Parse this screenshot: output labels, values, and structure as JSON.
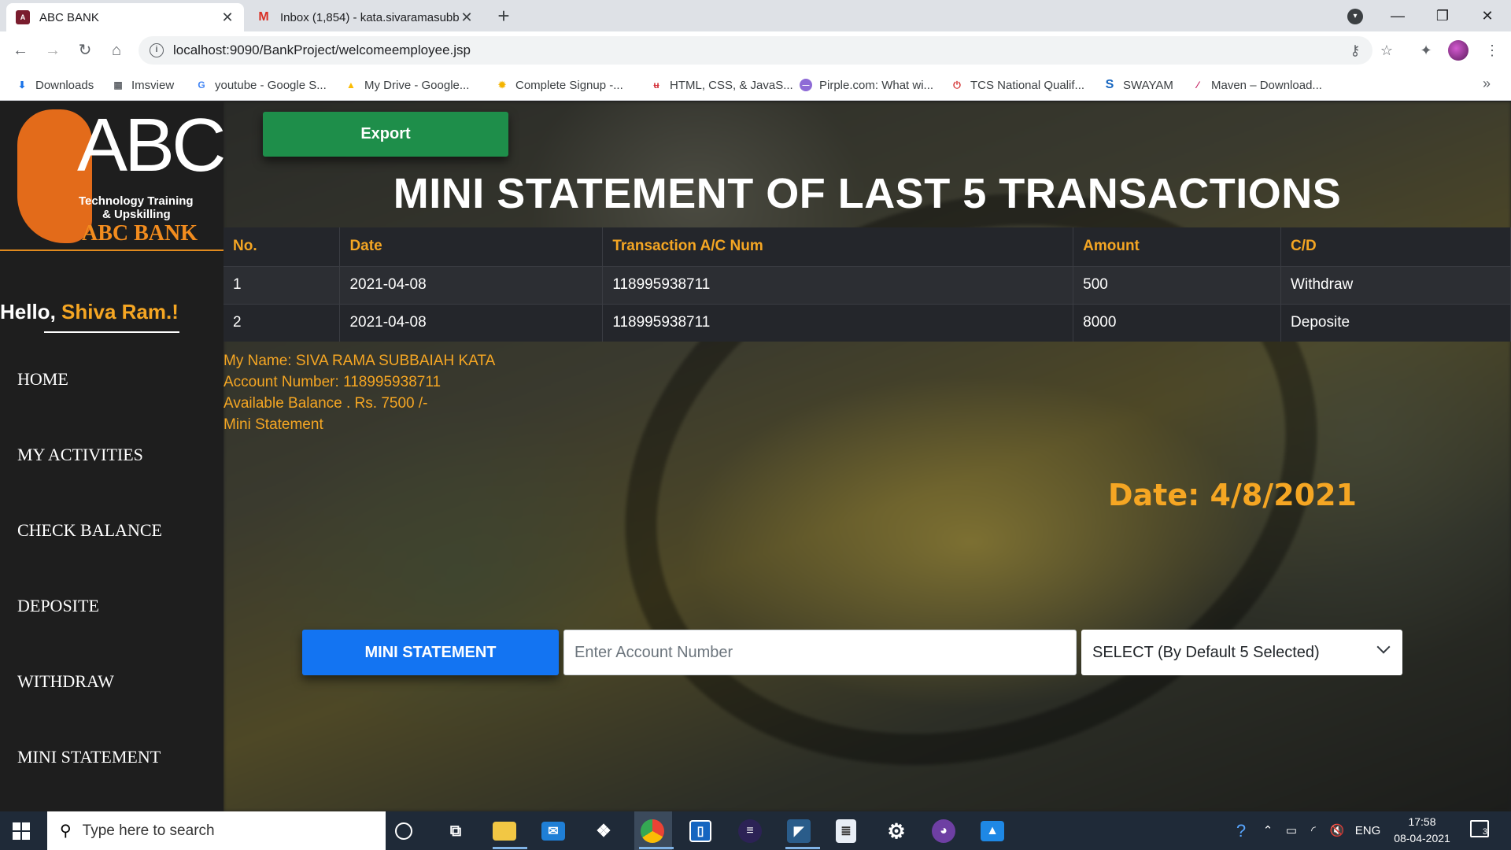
{
  "browser": {
    "tabs": [
      {
        "title": "ABC BANK",
        "icon": "abc-bank-favicon"
      },
      {
        "title": "Inbox (1,854) - kata.sivaramasubb",
        "icon": "gmail-icon"
      }
    ],
    "url": "localhost:9090/BankProject/welcomeemployee.jsp",
    "bookmarks": [
      "Downloads",
      "Imsview",
      "youtube - Google S...",
      "My Drive - Google...",
      "Complete Signup -...",
      "HTML, CSS, & JavaS...",
      "Pirple.com: What wi...",
      "TCS National Qualif...",
      "SWAYAM",
      "Maven – Download..."
    ]
  },
  "logo": {
    "abc": "ABC",
    "tagline_1": "Technology Training",
    "tagline_2": "& Upskilling",
    "bank_name": "ABC BANK"
  },
  "sidebar": {
    "hello": "Hello,",
    "user_name": "Shiva Ram.",
    "exclaim": "!",
    "menu": [
      "HOME",
      "MY ACTIVITIES",
      "CHECK BALANCE",
      "DEPOSITE",
      "WITHDRAW",
      "MINI STATEMENT"
    ]
  },
  "main": {
    "export_label": "Export",
    "heading": "MINI STATEMENT OF LAST 5 TRANSACTIONS",
    "table": {
      "headers": [
        "No.",
        "Date",
        "Transaction A/C Num",
        "Amount",
        "C/D"
      ],
      "rows": [
        [
          "1",
          "2021-04-08",
          "118995938711",
          "500",
          "Withdraw"
        ],
        [
          "2",
          "2021-04-08",
          "118995938711",
          "8000",
          "Deposite"
        ]
      ]
    },
    "info": {
      "name_line": "My Name: SIVA RAMA SUBBAIAH KATA",
      "account_line": "Account Number: 118995938711",
      "balance_line": "Available Balance . Rs. 7500 /-",
      "mini_line": "Mini Statement"
    },
    "date_display": "Date: 4/8/2021",
    "form": {
      "button_label": "MINI STATEMENT",
      "account_placeholder": "Enter Account Number",
      "select_value": "SELECT (By Default 5 Selected)"
    }
  },
  "taskbar": {
    "search_placeholder": "Type here to search",
    "language": "ENG",
    "time": "17:58",
    "date": "08-04-2021",
    "notification_count": "3"
  },
  "colors": {
    "accent_orange": "#f5a623",
    "export_green": "#1e8e4a",
    "primary_blue": "#1374f2",
    "sidebar_bg": "#1e1e1e"
  }
}
